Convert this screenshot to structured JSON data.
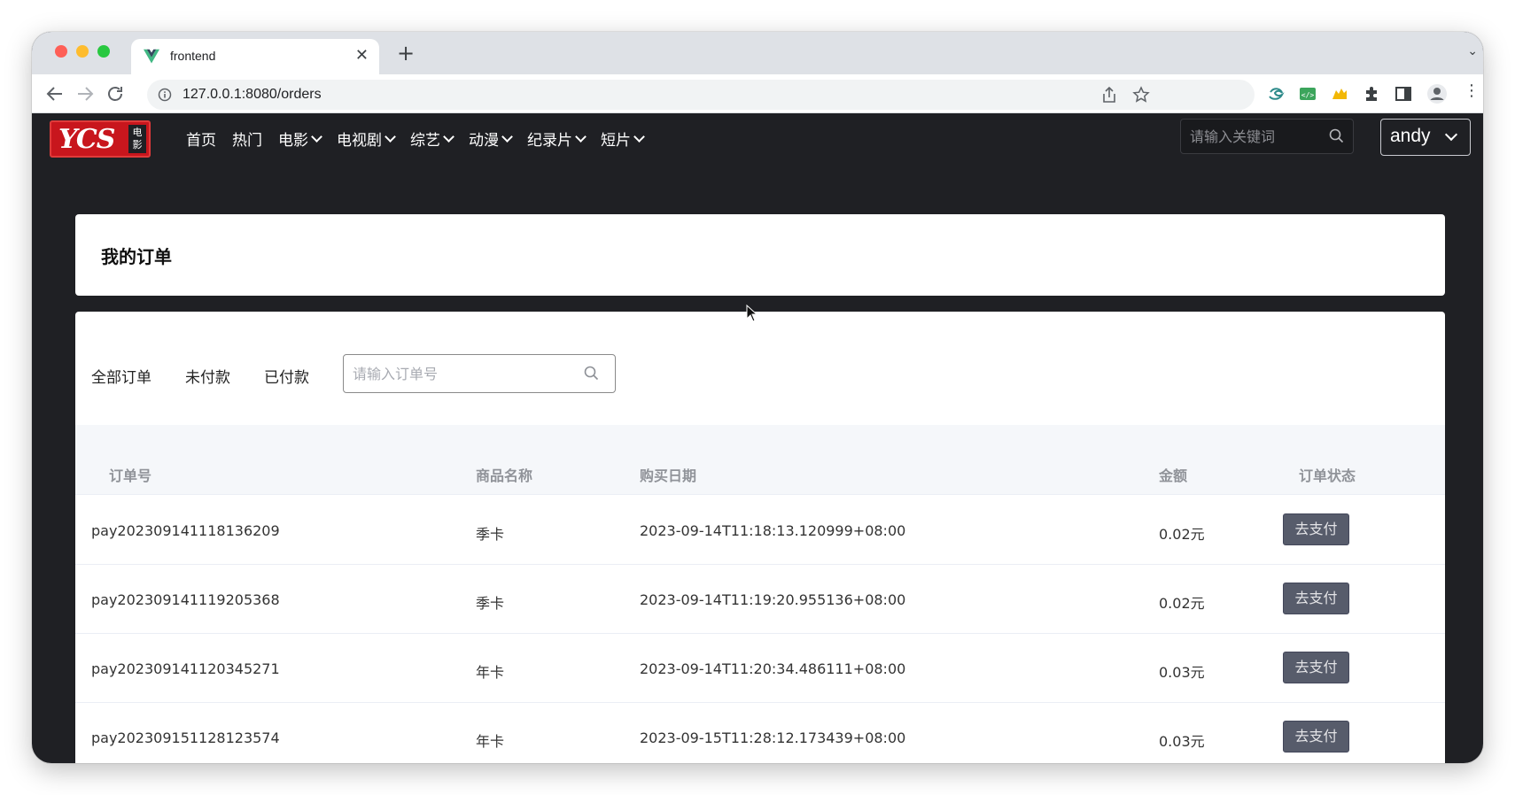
{
  "browser": {
    "tab_title": "frontend",
    "new_tab_symbol": "+",
    "close_symbol": "✕",
    "url": "127.0.0.1:8080/orders"
  },
  "app": {
    "logo_text": "YCS",
    "logo_sub": "电影",
    "menu": [
      {
        "label": "首页",
        "has_dropdown": false
      },
      {
        "label": "热门",
        "has_dropdown": false
      },
      {
        "label": "电影",
        "has_dropdown": true
      },
      {
        "label": "电视剧",
        "has_dropdown": true
      },
      {
        "label": "综艺",
        "has_dropdown": true
      },
      {
        "label": "动漫",
        "has_dropdown": true
      },
      {
        "label": "纪录片",
        "has_dropdown": true
      },
      {
        "label": "短片",
        "has_dropdown": true
      }
    ],
    "search_placeholder": "请输入关键词",
    "user_name": "andy"
  },
  "page": {
    "title": "我的订单",
    "filters": [
      "全部订单",
      "未付款",
      "已付款"
    ],
    "order_search_placeholder": "请输入订单号"
  },
  "table": {
    "columns": [
      "订单号",
      "商品名称",
      "购买日期",
      "金额",
      "订单状态"
    ],
    "rows": [
      {
        "order_no": "pay202309141118136209",
        "product": "季卡",
        "date": "2023-09-14T11:18:13.120999+08:00",
        "amount": "0.02元",
        "action": "去支付"
      },
      {
        "order_no": "pay202309141119205368",
        "product": "季卡",
        "date": "2023-09-14T11:19:20.955136+08:00",
        "amount": "0.02元",
        "action": "去支付"
      },
      {
        "order_no": "pay202309141120345271",
        "product": "年卡",
        "date": "2023-09-14T11:20:34.486111+08:00",
        "amount": "0.03元",
        "action": "去支付"
      },
      {
        "order_no": "pay202309151128123574",
        "product": "年卡",
        "date": "2023-09-15T11:28:12.173439+08:00",
        "amount": "0.03元",
        "action": "去支付"
      }
    ]
  },
  "colors": {
    "app_bg": "#1f2024",
    "pay_button": "#575c6b",
    "logo_red": "#c8161d"
  }
}
